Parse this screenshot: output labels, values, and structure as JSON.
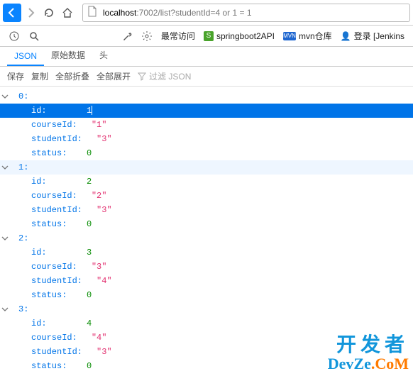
{
  "url_prefix": "localhost",
  "url_rest": ":7002/list?studentId=4 or 1 = 1",
  "bookmarks": {
    "most_visited": "最常访问",
    "springboot": "springboot2API",
    "mvn": "mvn仓库",
    "login": "登录 [Jenkins"
  },
  "tabs": {
    "json": "JSON",
    "raw": "原始数据",
    "head": "头"
  },
  "subbar": {
    "save": "保存",
    "copy": "复制",
    "collapse": "全部折叠",
    "expand": "全部展开",
    "filter": "过滤 JSON"
  },
  "json": [
    {
      "idx": "0:",
      "highlight": true,
      "fields": [
        {
          "k": "id:",
          "v": "1",
          "t": "num"
        },
        {
          "k": "courseId:",
          "v": "\"1\"",
          "t": "str"
        },
        {
          "k": "studentId:",
          "v": "\"3\"",
          "t": "str"
        },
        {
          "k": "status:",
          "v": "0",
          "t": "num"
        }
      ]
    },
    {
      "idx": "1:",
      "hover": true,
      "fields": [
        {
          "k": "id:",
          "v": "2",
          "t": "num"
        },
        {
          "k": "courseId:",
          "v": "\"2\"",
          "t": "str"
        },
        {
          "k": "studentId:",
          "v": "\"3\"",
          "t": "str"
        },
        {
          "k": "status:",
          "v": "0",
          "t": "num"
        }
      ]
    },
    {
      "idx": "2:",
      "fields": [
        {
          "k": "id:",
          "v": "3",
          "t": "num"
        },
        {
          "k": "courseId:",
          "v": "\"3\"",
          "t": "str"
        },
        {
          "k": "studentId:",
          "v": "\"4\"",
          "t": "str"
        },
        {
          "k": "status:",
          "v": "0",
          "t": "num"
        }
      ]
    },
    {
      "idx": "3:",
      "fields": [
        {
          "k": "id:",
          "v": "4",
          "t": "num"
        },
        {
          "k": "courseId:",
          "v": "\"4\"",
          "t": "str"
        },
        {
          "k": "studentId:",
          "v": "\"3\"",
          "t": "str"
        },
        {
          "k": "status:",
          "v": "0",
          "t": "num"
        }
      ]
    }
  ],
  "watermark": {
    "cn": "开发者",
    "en_pre": "DevZe",
    "en_post": ".CoM"
  }
}
